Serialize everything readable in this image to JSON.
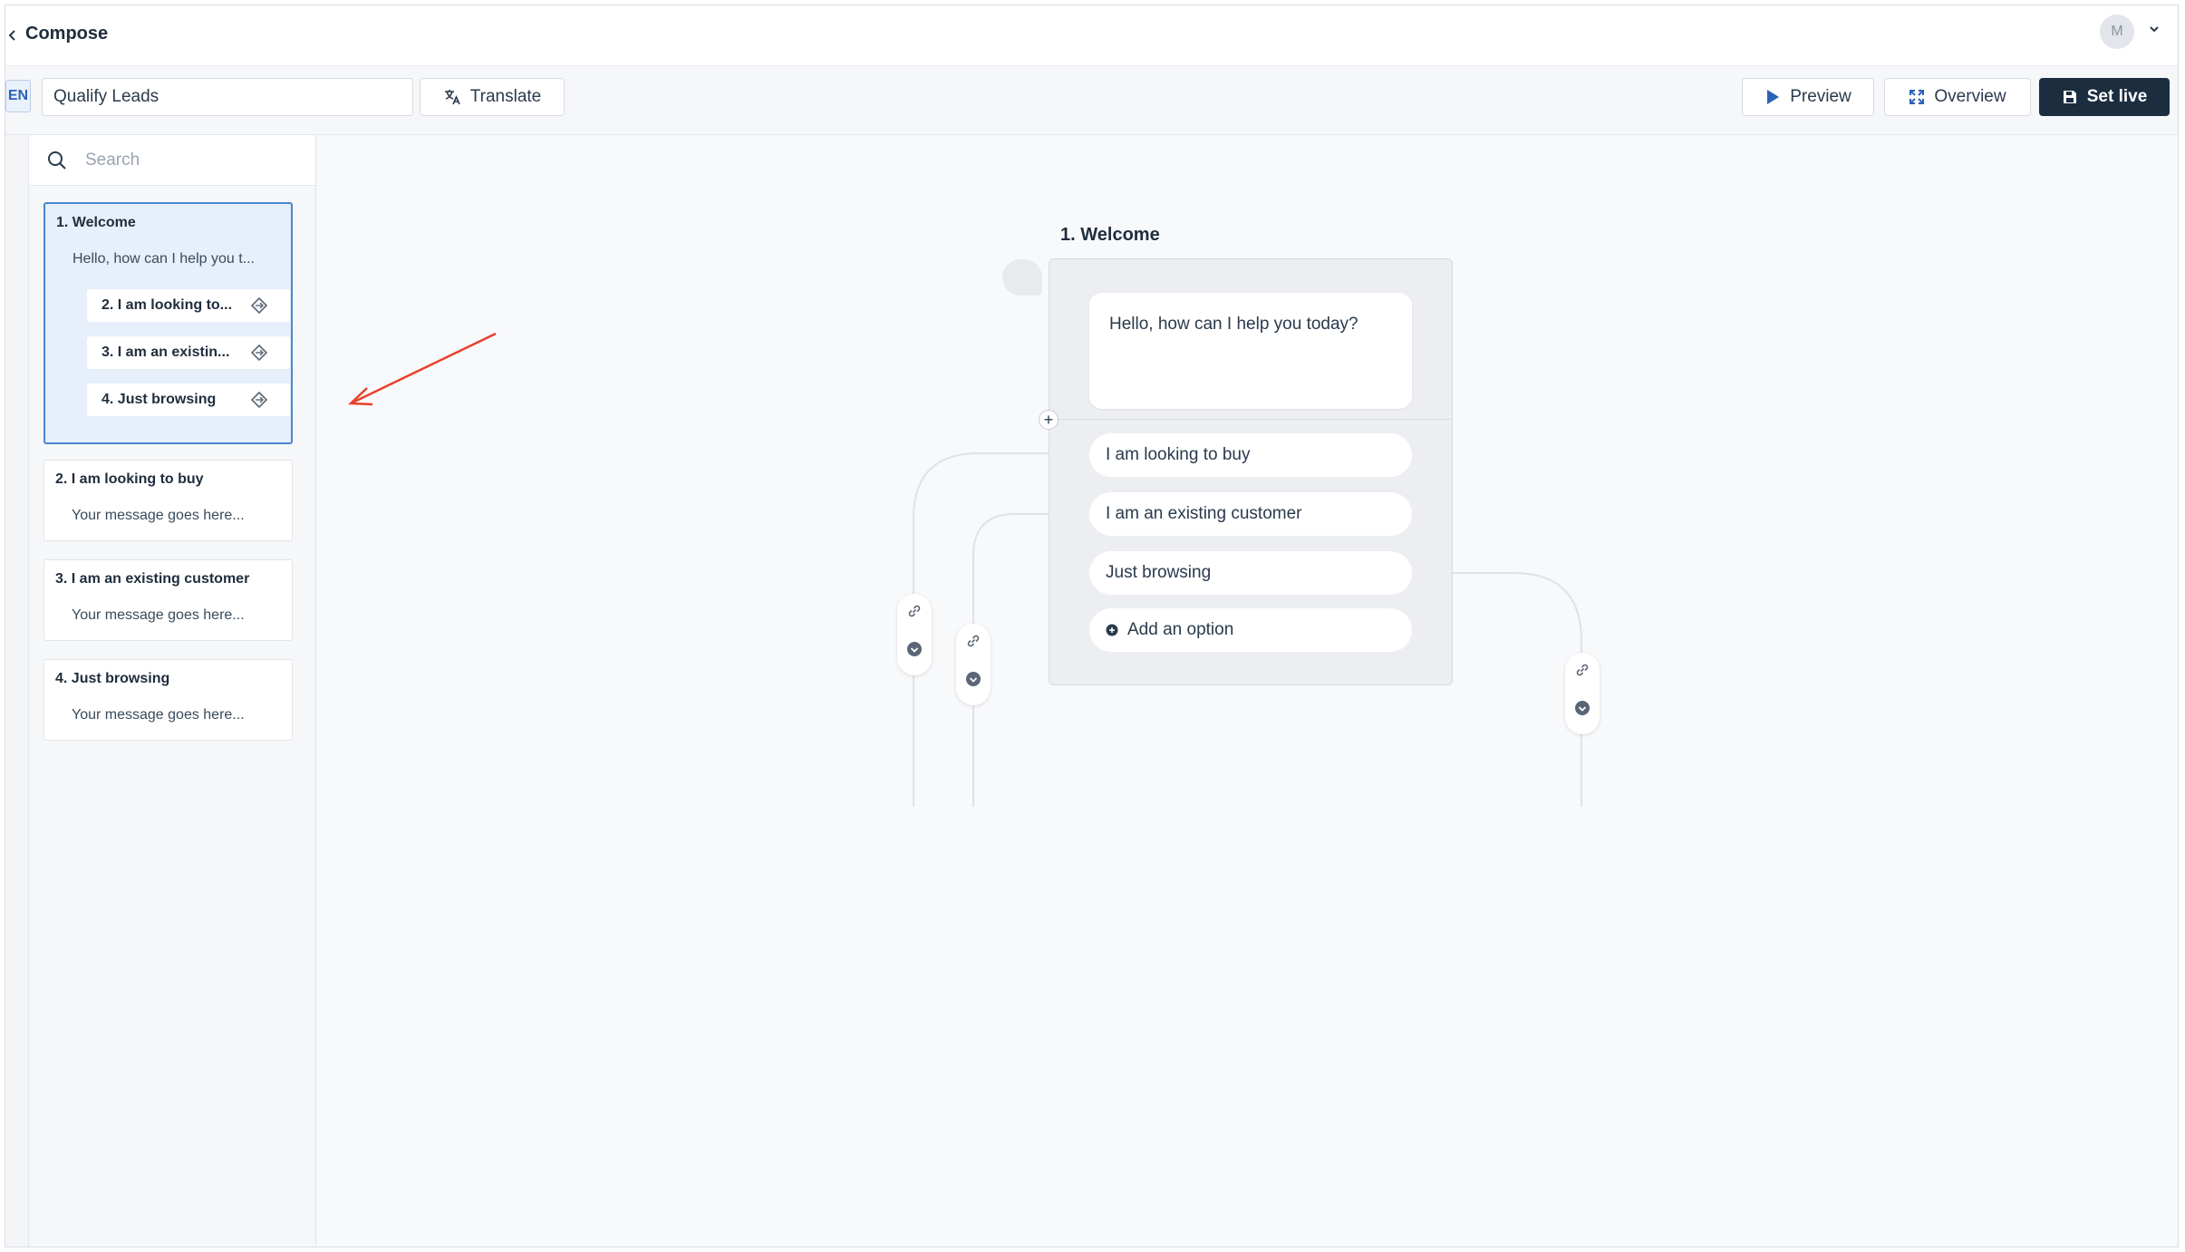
{
  "app": {
    "title": "Compose",
    "avatar_initial": "M"
  },
  "toolbar": {
    "language": "EN",
    "flow_name": "Qualify Leads",
    "translate_label": "Translate",
    "preview_label": "Preview",
    "overview_label": "Overview",
    "set_live_label": "Set live"
  },
  "sidebar": {
    "search_placeholder": "Search",
    "cards": [
      {
        "title": "1. Welcome",
        "message": "Hello, how can I help you t...",
        "options": [
          "2. I am looking to...",
          "3. I am an existin...",
          "4. Just browsing"
        ]
      },
      {
        "title": "2. I am looking to buy",
        "message": "Your message goes here..."
      },
      {
        "title": "3. I am an existing customer",
        "message": "Your message goes here..."
      },
      {
        "title": "4. Just browsing",
        "message": "Your message goes here..."
      }
    ]
  },
  "canvas": {
    "node_number": "1.",
    "node_name": "Welcome",
    "message": "Hello, how can I help you today?",
    "options": [
      "I am looking to buy",
      "I am an existing customer",
      "Just browsing"
    ],
    "add_option_label": "Add an option"
  },
  "colors": {
    "primary_dark": "#1c2d40",
    "accent_blue": "#4a86d0",
    "annotation_red": "#e8412c"
  }
}
